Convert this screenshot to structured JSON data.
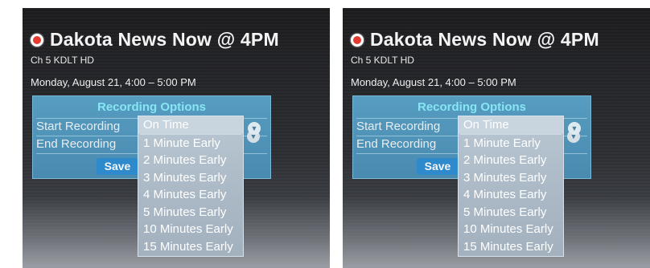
{
  "program": {
    "title": "Dakota News Now @ 4PM",
    "channel": "Ch 5  KDLT HD",
    "datetime": "Monday, August 21,  4:00 – 5:00 PM"
  },
  "recording_options": {
    "title": "Recording Options",
    "start_label": "Start Recording",
    "end_label": "End Recording",
    "save_label": "Save",
    "dropdown_arrow_icon": "chevron-down-icon"
  },
  "start_dropdown": {
    "options": [
      "On Time",
      "1 Minute Early",
      "2 Minutes Early",
      "3 Minutes Early",
      "4 Minutes Early",
      "5 Minutes Early",
      "10 Minutes Early",
      "15 Minutes Early"
    ],
    "selected": "On Time"
  },
  "colors": {
    "record_dot": "#e53a2f",
    "panel_blue": "#4b90b7",
    "panel_title": "#8cf0ff",
    "save_button": "#2e8fd3"
  }
}
